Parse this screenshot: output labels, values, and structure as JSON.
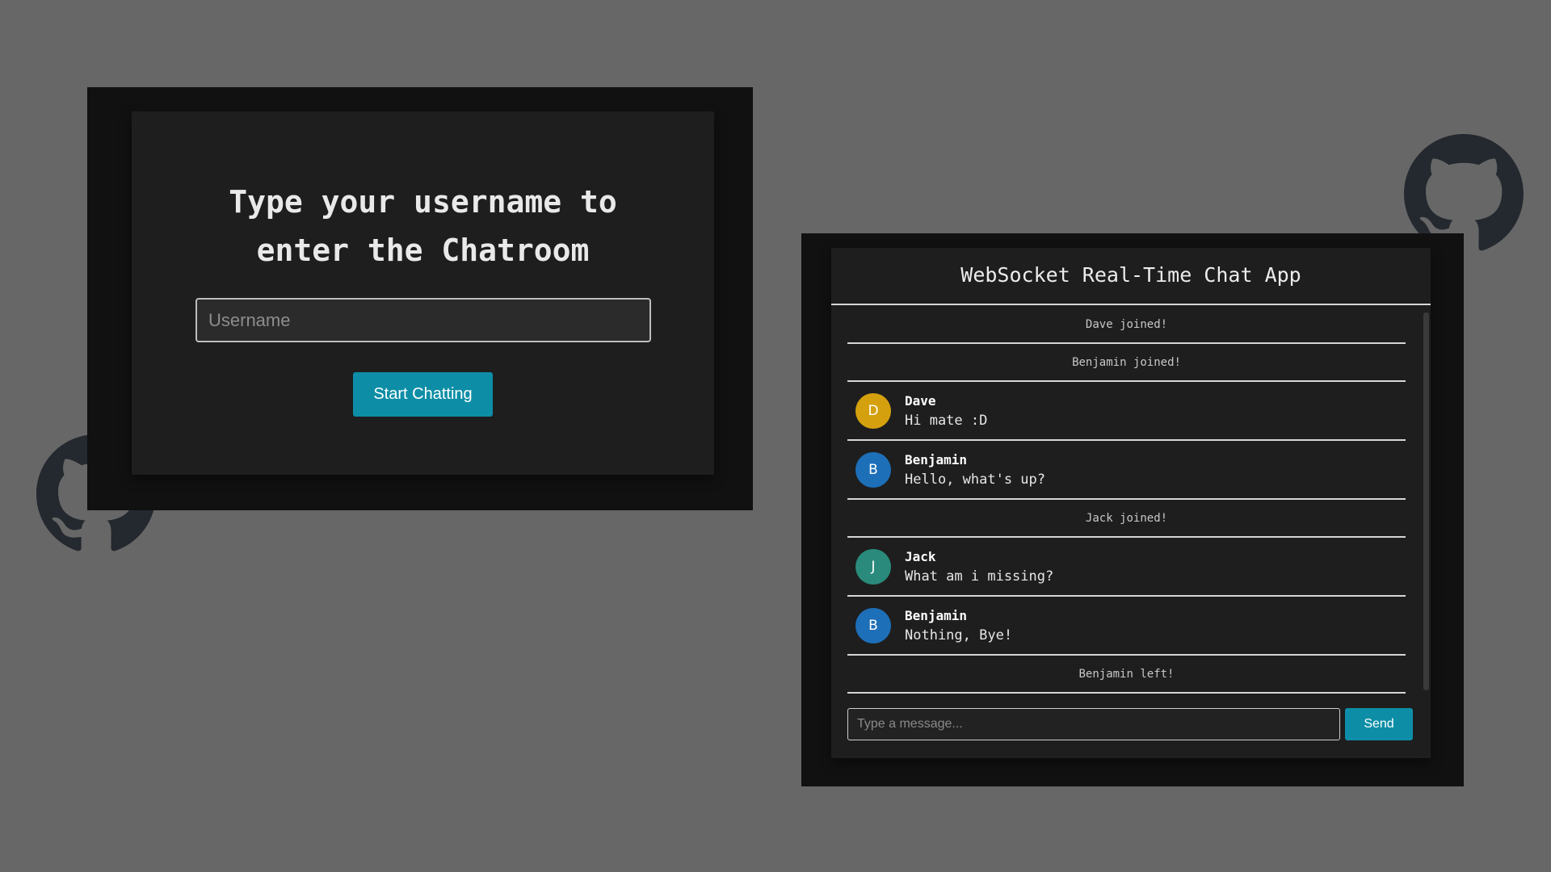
{
  "login": {
    "title": "Type your username to\nenter the Chatroom",
    "username_placeholder": "Username",
    "start_button_label": "Start Chatting",
    "button_color": "#0d8ea6"
  },
  "chat": {
    "title": "WebSocket Real-Time Chat App",
    "messages": [
      {
        "type": "system",
        "text": "Dave joined!"
      },
      {
        "type": "system",
        "text": "Benjamin joined!"
      },
      {
        "type": "user",
        "author": "Dave",
        "initial": "D",
        "color": "#d4a00e",
        "text": "Hi mate :D"
      },
      {
        "type": "user",
        "author": "Benjamin",
        "initial": "B",
        "color": "#1d6fb8",
        "text": "Hello, what's up?"
      },
      {
        "type": "system",
        "text": "Jack joined!"
      },
      {
        "type": "user",
        "author": "Jack",
        "initial": "J",
        "color": "#2a8a7c",
        "text": "What am i missing?"
      },
      {
        "type": "user",
        "author": "Benjamin",
        "initial": "B",
        "color": "#1d6fb8",
        "text": "Nothing, Bye!"
      },
      {
        "type": "system",
        "text": "Benjamin left!"
      }
    ],
    "input_placeholder": "Type a message...",
    "send_label": "Send"
  },
  "icons": {
    "left_logo": "github-icon",
    "right_logo": "github-icon"
  }
}
